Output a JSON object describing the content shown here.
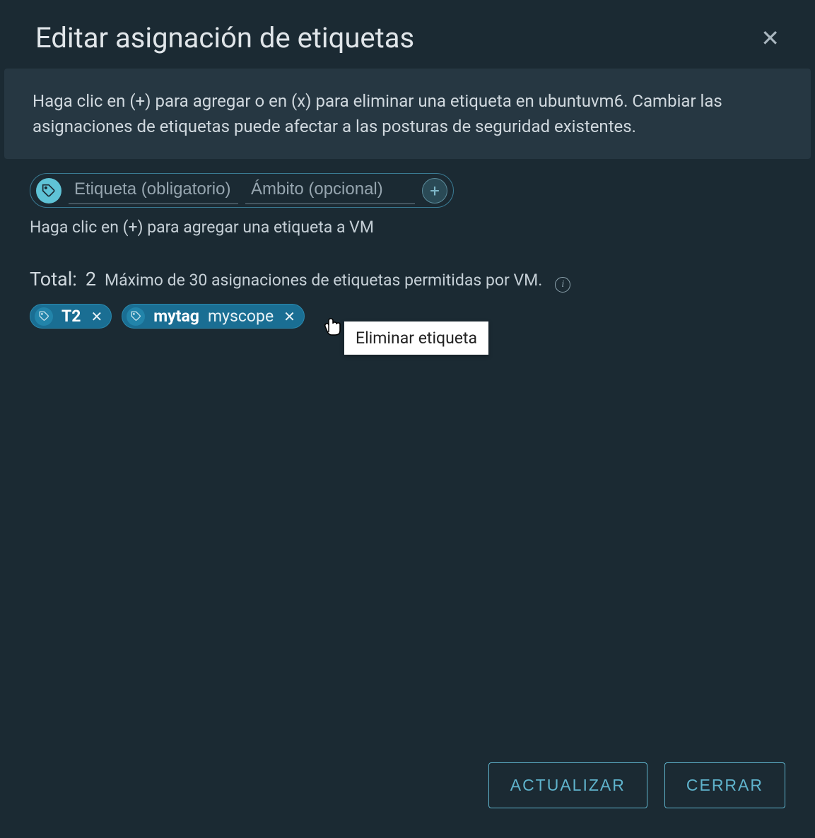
{
  "header": {
    "title": "Editar asignación de etiquetas"
  },
  "banner": {
    "text": "Haga clic en (+) para agregar o en (x) para eliminar una etiqueta en ubuntuvm6. Cambiar las asignaciones de etiquetas puede afectar a las posturas de seguridad existentes."
  },
  "inputs": {
    "tag_placeholder": "Etiqueta (obligatorio)",
    "scope_placeholder": "Ámbito (opcional)",
    "helper": "Haga clic en (+) para agregar una etiqueta a VM"
  },
  "total": {
    "label": "Total:",
    "count": "2",
    "max_text": "Máximo de 30 asignaciones de etiquetas permitidas por VM."
  },
  "tags": [
    {
      "name": "T2",
      "scope": ""
    },
    {
      "name": "mytag",
      "scope": "myscope"
    }
  ],
  "tooltip": {
    "text": "Eliminar etiqueta"
  },
  "footer": {
    "update": "ACTUALIZAR",
    "close": "CERRAR"
  }
}
